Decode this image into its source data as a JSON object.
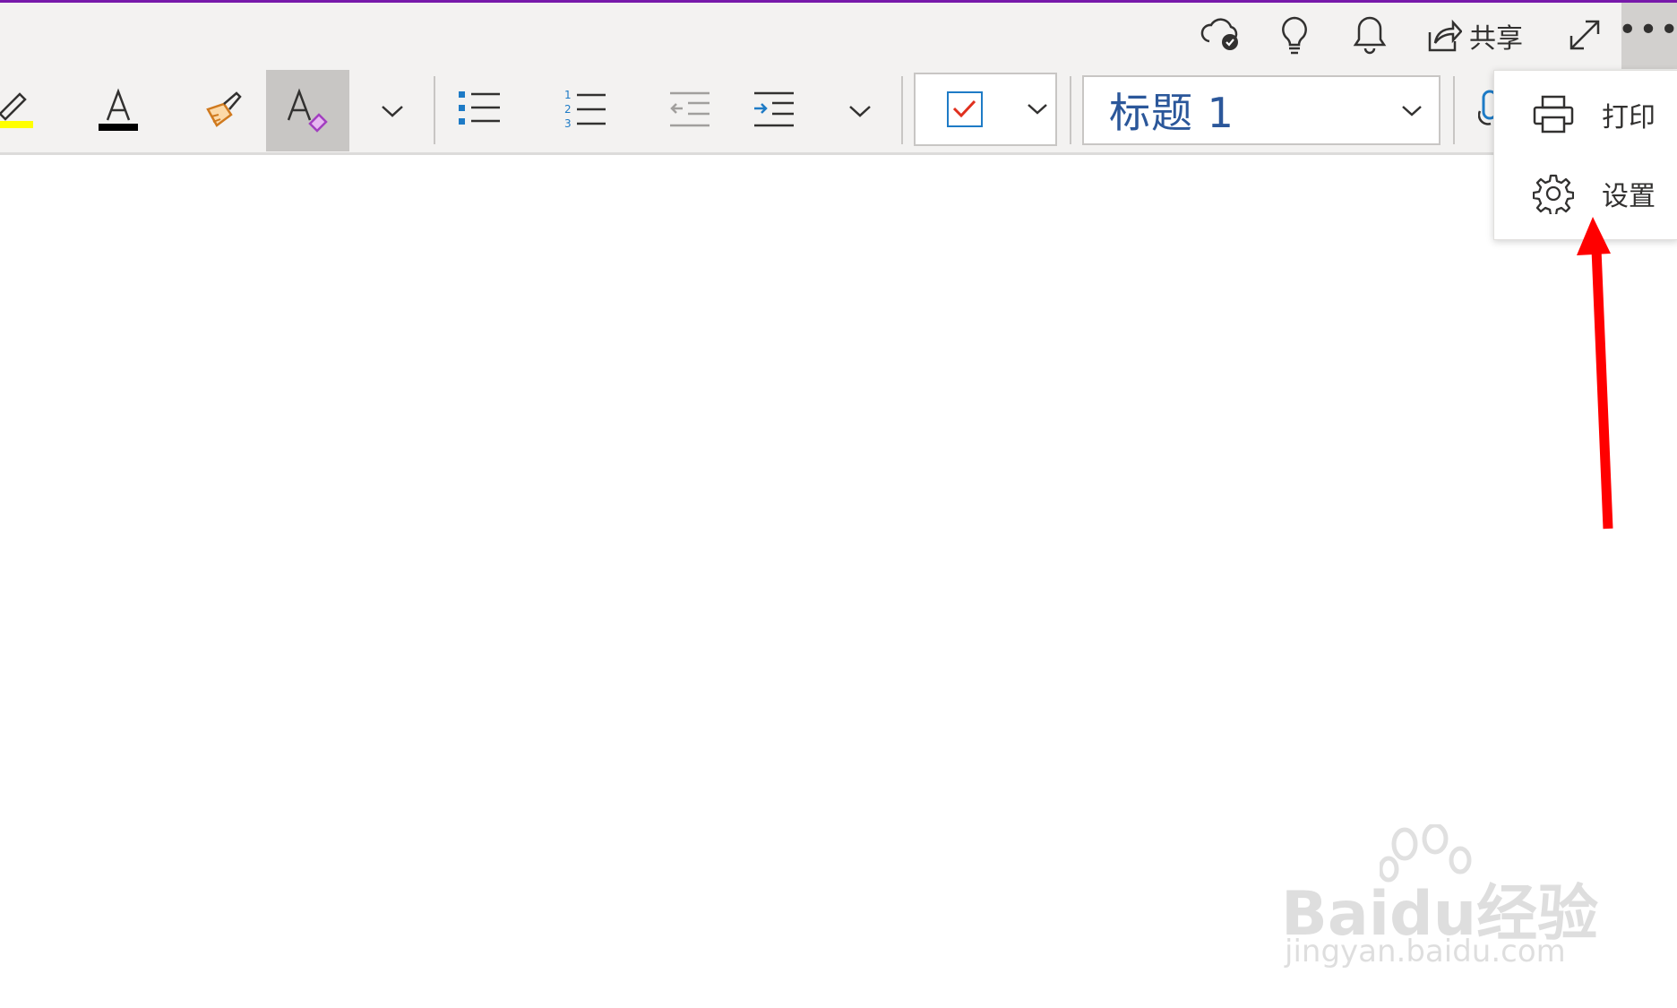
{
  "topbar": {
    "share_label": "共享",
    "icons": [
      "cloud-sync-icon",
      "lightbulb-icon",
      "bell-icon",
      "share-icon",
      "fullscreen-icon",
      "more-options-icon"
    ]
  },
  "ribbon": {
    "style_selected": "标题 1",
    "tags_checkbox": "checked",
    "icons": [
      "highlighter-icon",
      "font-color-icon",
      "format-painter-icon",
      "clear-formatting-icon",
      "chevron-down-icon",
      "bullet-list-icon",
      "numbered-list-icon",
      "decrease-indent-icon",
      "increase-indent-icon",
      "tag-checkbox-icon"
    ]
  },
  "more_menu": {
    "items": [
      {
        "label": "打印",
        "icon": "printer-icon"
      },
      {
        "label": "设置",
        "icon": "gear-icon"
      }
    ]
  },
  "watermark": {
    "brand": "Baidu经验",
    "url": "jingyan.baidu.com"
  },
  "colors": {
    "accent_purple": "#7719aa",
    "toolbar_bg": "#f3f2f1",
    "style_text": "#2b579a",
    "highlight_yellow": "#ffff00",
    "annotation_red": "#ff0000"
  }
}
